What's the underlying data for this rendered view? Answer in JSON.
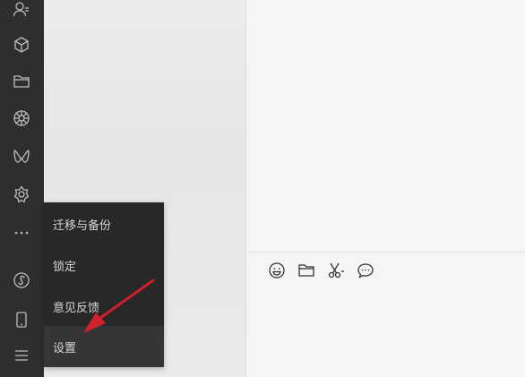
{
  "sidebar": {
    "icons": [
      {
        "name": "contacts-icon"
      },
      {
        "name": "mini-program-icon"
      },
      {
        "name": "folder-icon"
      },
      {
        "name": "moments-icon"
      },
      {
        "name": "channels-icon"
      },
      {
        "name": "search-icon"
      },
      {
        "name": "more-icon"
      },
      {
        "name": "mini-program-panel-icon"
      },
      {
        "name": "phone-icon"
      },
      {
        "name": "menu-icon"
      }
    ]
  },
  "menu": {
    "items": [
      {
        "label": "迁移与备份"
      },
      {
        "label": "锁定"
      },
      {
        "label": "意见反馈"
      },
      {
        "label": "设置"
      }
    ]
  },
  "toolbar": {
    "icons": [
      "emoji-icon",
      "file-icon",
      "screenshot-icon",
      "chat-history-icon"
    ]
  },
  "colors": {
    "sidebar_bg": "#2e2e2e",
    "menu_bg": "#282828",
    "annotation_arrow": "#d0202a"
  }
}
